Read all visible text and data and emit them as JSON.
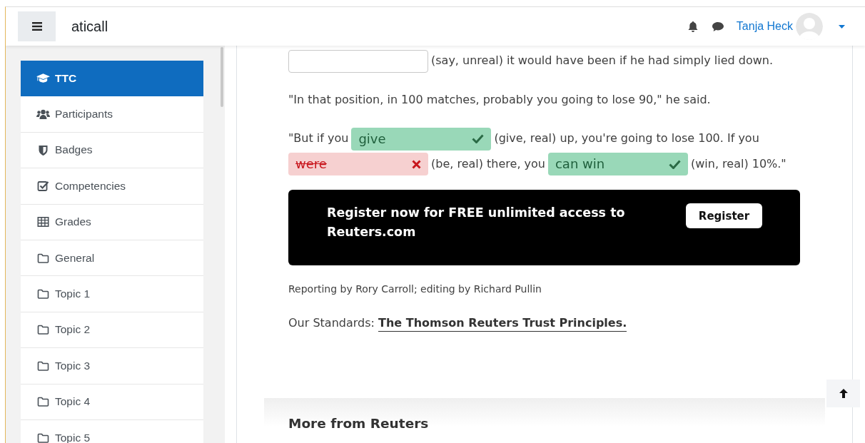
{
  "header": {
    "site_name": "aticall",
    "user_name": "Tanja Heck"
  },
  "sidebar": {
    "items": [
      {
        "label": "TTC",
        "selected": true
      },
      {
        "label": "Participants",
        "selected": false
      },
      {
        "label": "Badges",
        "selected": false
      },
      {
        "label": "Competencies",
        "selected": false
      },
      {
        "label": "Grades",
        "selected": false
      },
      {
        "label": "General",
        "selected": false
      },
      {
        "label": "Topic 1",
        "selected": false
      },
      {
        "label": "Topic 2",
        "selected": false
      },
      {
        "label": "Topic 3",
        "selected": false
      },
      {
        "label": "Topic 4",
        "selected": false
      },
      {
        "label": "Topic 5",
        "selected": false
      }
    ]
  },
  "paragraphs": [
    [
      {
        "kind": "blank"
      },
      {
        "kind": "text",
        "text": "(say, unreal) it would have been if he had simply lied down."
      }
    ],
    [
      {
        "kind": "text",
        "text": "\"In that position, in 100 matches, probably you going to lose 90,\" he said."
      }
    ],
    [
      {
        "kind": "text",
        "text": "\"But if you"
      },
      {
        "kind": "answer",
        "correct": true,
        "value": "give"
      },
      {
        "kind": "text",
        "text": "(give, real) up, you're going to lose 100. If you"
      },
      {
        "kind": "answer",
        "correct": false,
        "value": "were"
      },
      {
        "kind": "text",
        "text": "(be, real) there, you"
      },
      {
        "kind": "answer",
        "correct": true,
        "value": "can win"
      },
      {
        "kind": "text",
        "text": "(win, real) 10%.\""
      }
    ]
  ],
  "banner": {
    "text": "Register now for FREE unlimited access to Reuters.com",
    "button": "Register"
  },
  "byline": "Reporting by Rory Carroll; editing by Richard Pullin",
  "standards": {
    "label": "Our Standards:",
    "link": "The Thomson Reuters Trust Principles."
  },
  "more_section": {
    "title": "More from Reuters"
  }
}
